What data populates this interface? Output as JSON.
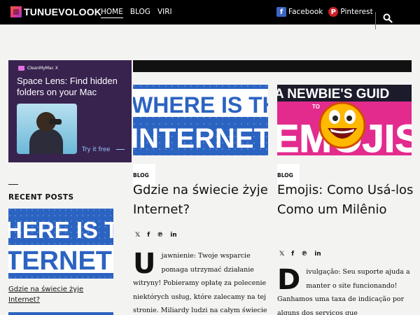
{
  "site": {
    "logo_text": "TUNUEVOLOOK"
  },
  "nav": {
    "items": [
      {
        "label": "HOME",
        "active": true
      },
      {
        "label": "BLOG",
        "active": false
      },
      {
        "label": "VIRI",
        "active": false
      }
    ]
  },
  "social": {
    "facebook_label": "Facebook",
    "pinterest_label": "Pinterest"
  },
  "ad": {
    "brand": "CleanMyMac X",
    "title": "Space Lens: Find hidden folders on your Mac",
    "cta": "Try it free"
  },
  "sidebar": {
    "heading": "RECENT POSTS",
    "recent_posts": [
      {
        "title": "Gdzie na świecie żyje Internet?",
        "thumb_text_line1": "HERE IS TH",
        "thumb_text_line2": "TERNET"
      }
    ]
  },
  "posts": [
    {
      "category": "BLOG",
      "title": "Gdzie na świecie żyje Internet?",
      "image_text_line1": "WHERE IS TH",
      "image_text_line2": "INTERNET?",
      "dropcap": "U",
      "excerpt": "jawnienie: Twoje wsparcie pomaga utrzymać działanie witryny! Pobieramy opłatę za polecenie niektórych usług, które zalecamy na tej stronie. Miliardy ludzi na całym świecie korzystają z Internetu"
    },
    {
      "category": "BLOG",
      "title": "Emojis: Como Usá-los Como um Milênio",
      "image_text_line1": "A NEWBIE'S GUID",
      "image_text_line2": "EMOJIS",
      "image_text_small": "TO",
      "dropcap": "D",
      "excerpt": "ivulgação: Seu suporte ajuda a manter o site funcionando! Ganhamos uma taxa de indicação por alguns dos serviços que"
    }
  ],
  "colors": {
    "topbar": "#000000",
    "page_bg": "#f3f3f1",
    "ad_bg": "#38234f",
    "internet_thumb_bg": "#2b63c1",
    "emoji_thumb_bg": "#e32b8e"
  },
  "icons": {
    "search": "search-icon",
    "twitter": "twitter-icon",
    "facebook": "facebook-icon",
    "pinterest": "pinterest-icon",
    "linkedin": "linkedin-icon"
  }
}
